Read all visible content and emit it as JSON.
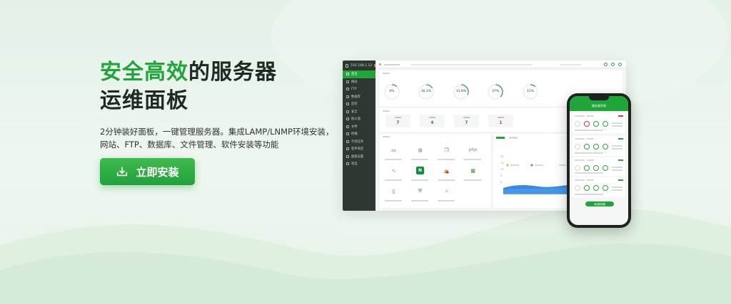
{
  "hero": {
    "title_accent": "安全高效",
    "title_rest": "的服务器",
    "title_line2": "运维面板",
    "desc_line1": "2分钟装好面板，一键管理服务器。集成LAMP/LNMP环境安装，",
    "desc_line2": "网站、FTP、数据库、文件管理、软件安装等功能",
    "cta_label": "立即安装"
  },
  "dashboard": {
    "brand": "192.168.1.12",
    "sidebar": [
      "首页",
      "网站",
      "FTP",
      "数据库",
      "监控",
      "安全",
      "防火墙",
      "文件",
      "终端",
      "计划任务",
      "软件商店",
      "面板设置",
      "退出"
    ],
    "gauges": [
      "6%",
      "16.1%",
      "31.8%",
      "37%",
      "11%"
    ],
    "stats": [
      "7",
      "4",
      "7",
      "1"
    ],
    "apps": [
      "monitor",
      "globe",
      "window",
      "php",
      "tomcat",
      "nginx",
      "lamp",
      "grid",
      "pipe",
      "shield",
      "tools"
    ],
    "chart_yticks": [
      "20",
      "15",
      "10",
      "5",
      "0"
    ]
  },
  "phone": {
    "title": "服务器列表",
    "button": "添加服务器"
  },
  "colors": {
    "accent": "#20a53a",
    "sidebar": "#2f3733",
    "danger": "#d9363e"
  }
}
